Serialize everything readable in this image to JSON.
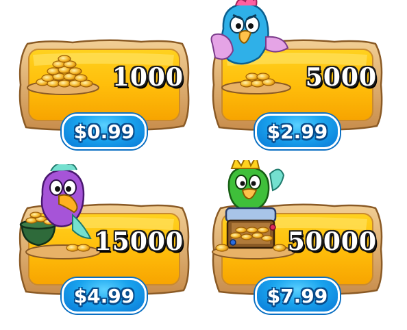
{
  "store": {
    "packs": [
      {
        "amount": "1000",
        "price": "$0.99",
        "icon": "coin-pile-icon"
      },
      {
        "amount": "5000",
        "price": "$2.99",
        "icon": "blue-parrot-coins-icon"
      },
      {
        "amount": "15000",
        "price": "$4.99",
        "icon": "purple-parrot-pot-icon"
      },
      {
        "amount": "50000",
        "price": "$7.99",
        "icon": "green-parrot-treasure-chest-icon"
      }
    ]
  },
  "colors": {
    "panel_fill": "#ffc107",
    "panel_frame": "#d9a15a",
    "price_badge": "#1aa4ee"
  }
}
